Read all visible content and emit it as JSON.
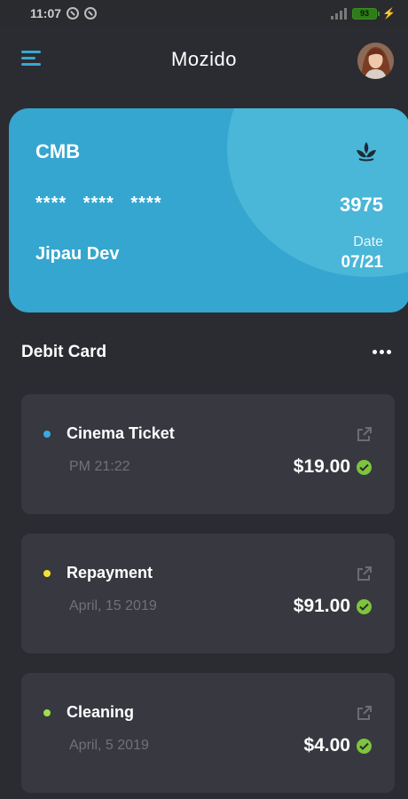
{
  "status": {
    "time": "11:07",
    "battery": "93"
  },
  "app": {
    "title": "Mozido"
  },
  "card": {
    "bank": "CMB",
    "masked": "**** **** ****",
    "last4": "3975",
    "holder": "Jipau Dev",
    "date_label": "Date",
    "date": "07/21"
  },
  "section": {
    "title": "Debit Card"
  },
  "transactions": [
    {
      "title": "Cinema Ticket",
      "subtitle": "PM 21:22",
      "amount": "$19.00",
      "dot_color": "#3aa9e0"
    },
    {
      "title": "Repayment",
      "subtitle": "April, 15 2019",
      "amount": "$91.00",
      "dot_color": "#f4e232"
    },
    {
      "title": "Cleaning",
      "subtitle": "April, 5 2019",
      "amount": "$4.00",
      "dot_color": "#9ee04a"
    }
  ],
  "colors": {
    "background": "#2b2c31",
    "card": "#35a6cf",
    "accent": "#36a8d4",
    "success": "#7ec43c"
  }
}
